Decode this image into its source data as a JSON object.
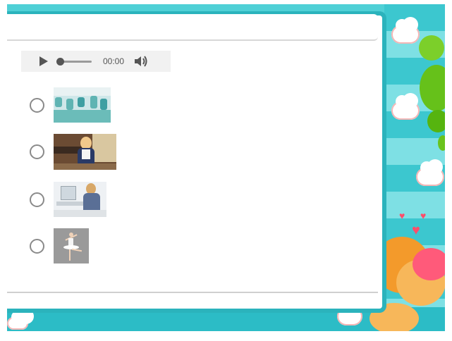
{
  "audio": {
    "time": "00:00",
    "progress": 0
  },
  "options": [
    {
      "id": "a",
      "image": "factory-workers-photo"
    },
    {
      "id": "b",
      "image": "businesswoman-photo"
    },
    {
      "id": "c",
      "image": "office-worker-photo"
    },
    {
      "id": "d",
      "image": "ballet-dancer-photo"
    }
  ],
  "colors": {
    "frame": "#4fd0d6",
    "stripe_dark": "#3cc7cf",
    "stripe_light": "#7ee0e4",
    "panel_border": "#2bb3bc",
    "audio_bg": "#f1f1f1"
  }
}
